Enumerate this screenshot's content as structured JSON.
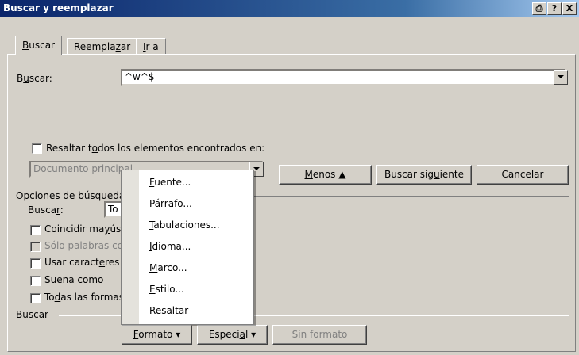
{
  "window": {
    "title": "Buscar y reemplazar",
    "buttons": [
      "⎙",
      "?",
      "X"
    ]
  },
  "tabs": [
    {
      "label": "Buscar",
      "accel": "B",
      "rest": "uscar"
    },
    {
      "label": "Reemplazar",
      "pre": "Reempla",
      "accel": "z",
      "rest": "ar"
    },
    {
      "label": "Ir a",
      "accel": "I",
      "rest": "r a"
    }
  ],
  "search": {
    "label_pre": "B",
    "label_accel": "u",
    "label_rest": "scar:",
    "value": "^w^$"
  },
  "highlight": {
    "pre": "Resaltar t",
    "accel": "o",
    "rest": "dos los elementos encontrados en:",
    "checked": false,
    "scope": "Documento principal"
  },
  "buttons": {
    "less": "Menos ⯅",
    "less_accel": "M",
    "less_rest": "enos",
    "find_next_pre": "Buscar sig",
    "find_next_accel": "u",
    "find_next_rest": "iente",
    "cancel": "Cancelar"
  },
  "options": {
    "heading": "Opciones de búsqueda",
    "search_pre": "Busca",
    "search_accel": "r",
    "search_rest": ":",
    "search_value": "To",
    "checkboxes": [
      {
        "pre": "Coincidir ma",
        "accel": "y",
        "rest": "úsc",
        "enabled": true
      },
      {
        "pre": "Sólo palabras co",
        "accel": "",
        "rest": "",
        "enabled": false
      },
      {
        "pre": "Usar caract",
        "accel": "e",
        "rest": "res",
        "enabled": true
      },
      {
        "pre": "Suena ",
        "accel": "c",
        "rest": "omo",
        "enabled": true
      },
      {
        "pre": "To",
        "accel": "d",
        "rest": "as las formas",
        "enabled": true
      }
    ]
  },
  "find_section": {
    "label": "Buscar",
    "format_accel": "F",
    "format_rest": "ormato ▾",
    "special_pre": "Especi",
    "special_accel": "a",
    "special_rest": "l ▾",
    "no_format": "Sin formato"
  },
  "format_menu": {
    "items": [
      {
        "accel": "F",
        "rest": "uente..."
      },
      {
        "accel": "P",
        "rest": "árrafo..."
      },
      {
        "accel": "T",
        "rest": "abulaciones..."
      },
      {
        "accel": "I",
        "rest": "dioma..."
      },
      {
        "accel": "M",
        "rest": "arco..."
      },
      {
        "accel": "E",
        "rest": "stilo..."
      },
      {
        "accel": "R",
        "rest": "esaltar"
      }
    ]
  }
}
